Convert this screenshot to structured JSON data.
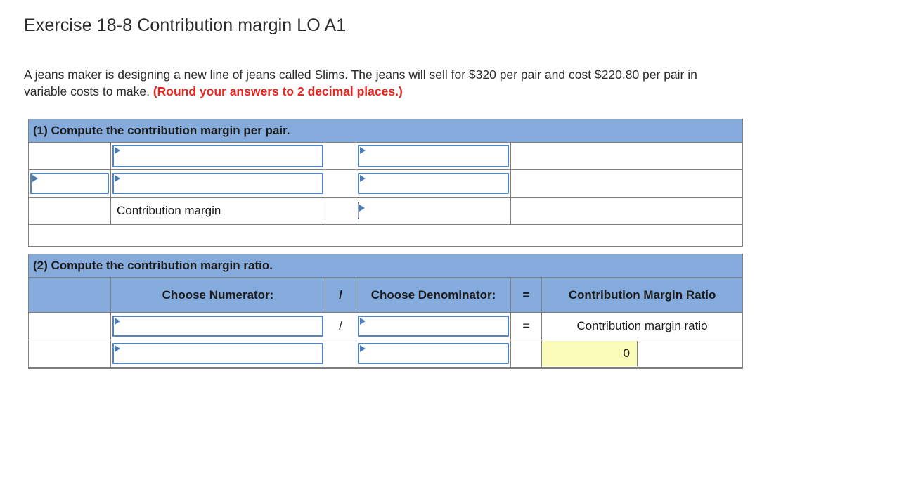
{
  "page": {
    "title": "Exercise 18-8 Contribution margin LO A1",
    "intro_text": "A jeans maker is designing a new line of jeans called Slims. The jeans will sell for $320 per pair and cost $220.80 per pair in variable costs to make. ",
    "intro_emphasis": "(Round your answers to 2 decimal places.)",
    "emphasis_color": "#e8251f"
  },
  "part1": {
    "banner": "(1) Compute the contribution margin per pair.",
    "rows": [
      {
        "col1_value": "",
        "col1_is_select": false,
        "col2_value": "",
        "col2_is_select": true,
        "col4_value": "",
        "col4_is_select": true,
        "col5_value": ""
      },
      {
        "col1_value": "",
        "col1_is_select": true,
        "col2_value": "",
        "col2_is_select": true,
        "col4_value": "",
        "col4_is_select": true,
        "col5_value": ""
      },
      {
        "col1_value": "",
        "col1_is_select": false,
        "col2_value": "Contribution margin",
        "col2_is_select": false,
        "col4_value": "",
        "col4_is_answer": true,
        "col5_value": ""
      }
    ],
    "answer_value": ""
  },
  "part2": {
    "banner": "(2) Compute the contribution margin ratio.",
    "headers": [
      "",
      "Choose Numerator:",
      "/",
      "Choose Denominator:",
      "=",
      "Contribution Margin Ratio"
    ],
    "rows": [
      {
        "col1": "",
        "numerator": "",
        "operator": "/",
        "denominator": "",
        "equals": "=",
        "result_label": "Contribution margin ratio",
        "result_is_answer": false
      },
      {
        "col1": "",
        "numerator": "",
        "operator": "",
        "denominator": "",
        "equals": "",
        "result_label": "0",
        "result_is_answer": true
      }
    ]
  },
  "colors": {
    "banner_blue": "#85abdd",
    "answer_yellow": "#fafab9",
    "select_border": "#5584c0",
    "grid_gray": "#808080"
  }
}
